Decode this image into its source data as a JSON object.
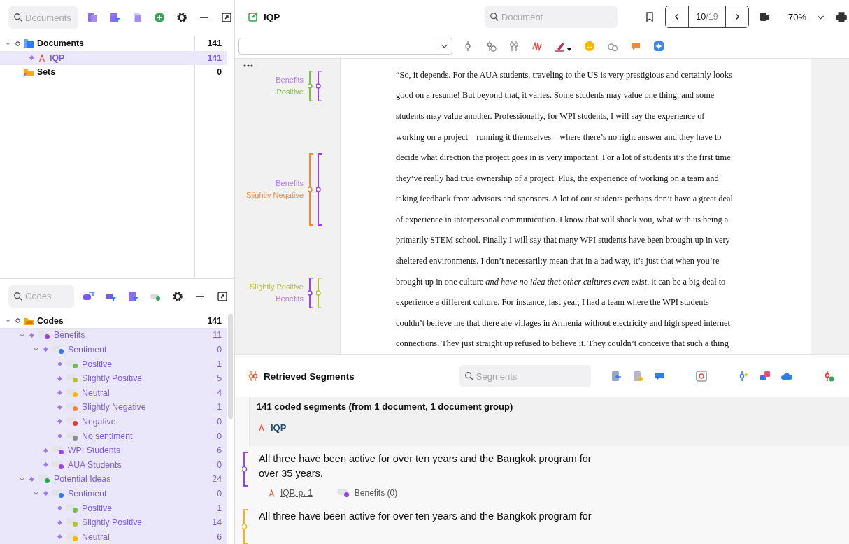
{
  "documents": {
    "search": {
      "placeholder": "Documents"
    },
    "tree": [
      {
        "kind": "folder",
        "label": "Documents",
        "count": "141",
        "selected": false,
        "expanded": true,
        "children": [
          {
            "kind": "pdf",
            "label": "IQP",
            "count": "141",
            "selected": true
          }
        ]
      },
      {
        "kind": "sets",
        "label": "Sets",
        "count": "0",
        "selected": false
      }
    ]
  },
  "codes": {
    "search": {
      "placeholder": "Codes"
    },
    "tree": [
      {
        "kind": "folder",
        "label": "Codes",
        "count": "141",
        "selected": false,
        "expanded": true,
        "children": [
          {
            "kind": "code",
            "label": "Benefits",
            "count": "11",
            "color": "#a040e8",
            "selected": true,
            "expanded": true,
            "children": [
              {
                "kind": "code",
                "label": "Sentiment",
                "count": "0",
                "color": "#2f7bef",
                "selected": true,
                "expanded": true,
                "children": [
                  {
                    "kind": "code",
                    "label": "Positive",
                    "count": "1",
                    "color": "#6cc04a",
                    "selected": true
                  },
                  {
                    "kind": "code",
                    "label": "Slightly Positive",
                    "count": "5",
                    "color": "#b5c22c",
                    "selected": true
                  },
                  {
                    "kind": "code",
                    "label": "Neutral",
                    "count": "4",
                    "color": "#f5b700",
                    "selected": true
                  },
                  {
                    "kind": "code",
                    "label": "Slightly Negative",
                    "count": "1",
                    "color": "#f08a3a",
                    "selected": true
                  },
                  {
                    "kind": "code",
                    "label": "Negative",
                    "count": "0",
                    "color": "#e53935",
                    "selected": true
                  },
                  {
                    "kind": "code",
                    "label": "No sentiment",
                    "count": "0",
                    "color": "#8a8a8a",
                    "selected": true
                  }
                ]
              },
              {
                "kind": "code",
                "label": "WPI Students",
                "count": "6",
                "color": "#a040e8",
                "selected": true
              },
              {
                "kind": "code",
                "label": "AUA Students",
                "count": "0",
                "color": "#a040e8",
                "selected": true
              }
            ]
          },
          {
            "kind": "code",
            "label": "Potential Ideas",
            "count": "24",
            "color": "#22b14c",
            "selected": true,
            "expanded": true,
            "children": [
              {
                "kind": "code",
                "label": "Sentiment",
                "count": "0",
                "color": "#2f7bef",
                "selected": true,
                "expanded": true,
                "children": [
                  {
                    "kind": "code",
                    "label": "Positive",
                    "count": "1",
                    "color": "#6cc04a",
                    "selected": true
                  },
                  {
                    "kind": "code",
                    "label": "Slightly Positive",
                    "count": "14",
                    "color": "#b5c22c",
                    "selected": true
                  },
                  {
                    "kind": "code",
                    "label": "Neutral",
                    "count": "6",
                    "color": "#f5b700",
                    "selected": true
                  }
                ]
              }
            ]
          }
        ]
      }
    ]
  },
  "editor": {
    "title": "IQP",
    "search": {
      "placeholder": "Document"
    },
    "page": "10",
    "page_total": "/19",
    "zoom": "70%",
    "margin_groups": [
      {
        "brackets": [
          {
            "color": "#7cc242"
          },
          {
            "color": "#a040e8"
          }
        ],
        "labels": [
          {
            "text": "Benefits",
            "color": "#b77ae8"
          },
          {
            "text": "..Positive",
            "color": "#7cc242"
          }
        ]
      },
      {
        "brackets": [
          {
            "color": "#f08a3a"
          },
          {
            "color": "#a040e8"
          }
        ],
        "labels": [
          {
            "text": "Benefits",
            "color": "#b77ae8"
          },
          {
            "text": "..Slightly Negative",
            "color": "#f08a3a"
          }
        ]
      },
      {
        "brackets": [
          {
            "color": "#a040e8"
          },
          {
            "color": "#b5c22c"
          }
        ],
        "labels": [
          {
            "text": "..Slightly Positive",
            "color": "#b5c22c"
          },
          {
            "text": "Benefits",
            "color": "#b77ae8"
          }
        ]
      }
    ],
    "lines": [
      "“So, it depends. For the AUA students, traveling to the US is very prestigious and certainly looks",
      "good on a resume! But beyond that, it varies. Some students may value one thing, and some",
      "students may value another. Professionally, for WPI students, I will say the experience of",
      "working on a project – running it themselves – where there’s no right answer and they have to",
      "decide what direction the project goes in is very important. For a lot of students it’s the first time",
      "they’ve really had true ownership of a project. Plus, the experience of working on a team and",
      "taking feedback from advisors and sponsors. A lot of our students perhaps don’t have a great deal",
      "of experience in interpersonal communication. I know that will shock you, what with us being a",
      "primarily STEM school. Finally I will say that many WPI students have been brought up in very",
      "sheltered environments. I don’t necessaril;y mean that in a bad way, it’s just that when you’re",
      "brought up in one culture *and have no idea that other cultures even exist*, it can be a big deal to",
      "experience a different culture. For instance, last year, I had a team where the WPI students",
      "couldn’t believe me that there are villages in Armenia without electricity and high speed internet",
      "connections. They just straight up refused to believe it. They couldn’t conceive that such a thing"
    ]
  },
  "retrieved": {
    "title": "Retrieved Segments",
    "search": {
      "placeholder": "Segments"
    },
    "summary": "141 coded segments (from 1 document, 1 document group)",
    "document": "IQP",
    "segments": [
      {
        "color": "#a040e8",
        "text": "All three have been active for over ten years and the Bangkok program for over 35 years.",
        "source": "IQP, p. 1",
        "code": {
          "label": "Benefits (0)",
          "color": "#a040e8"
        }
      },
      {
        "color": "#f5b700",
        "text": "All three have been active for over ten years and the Bangkok program for"
      }
    ]
  }
}
